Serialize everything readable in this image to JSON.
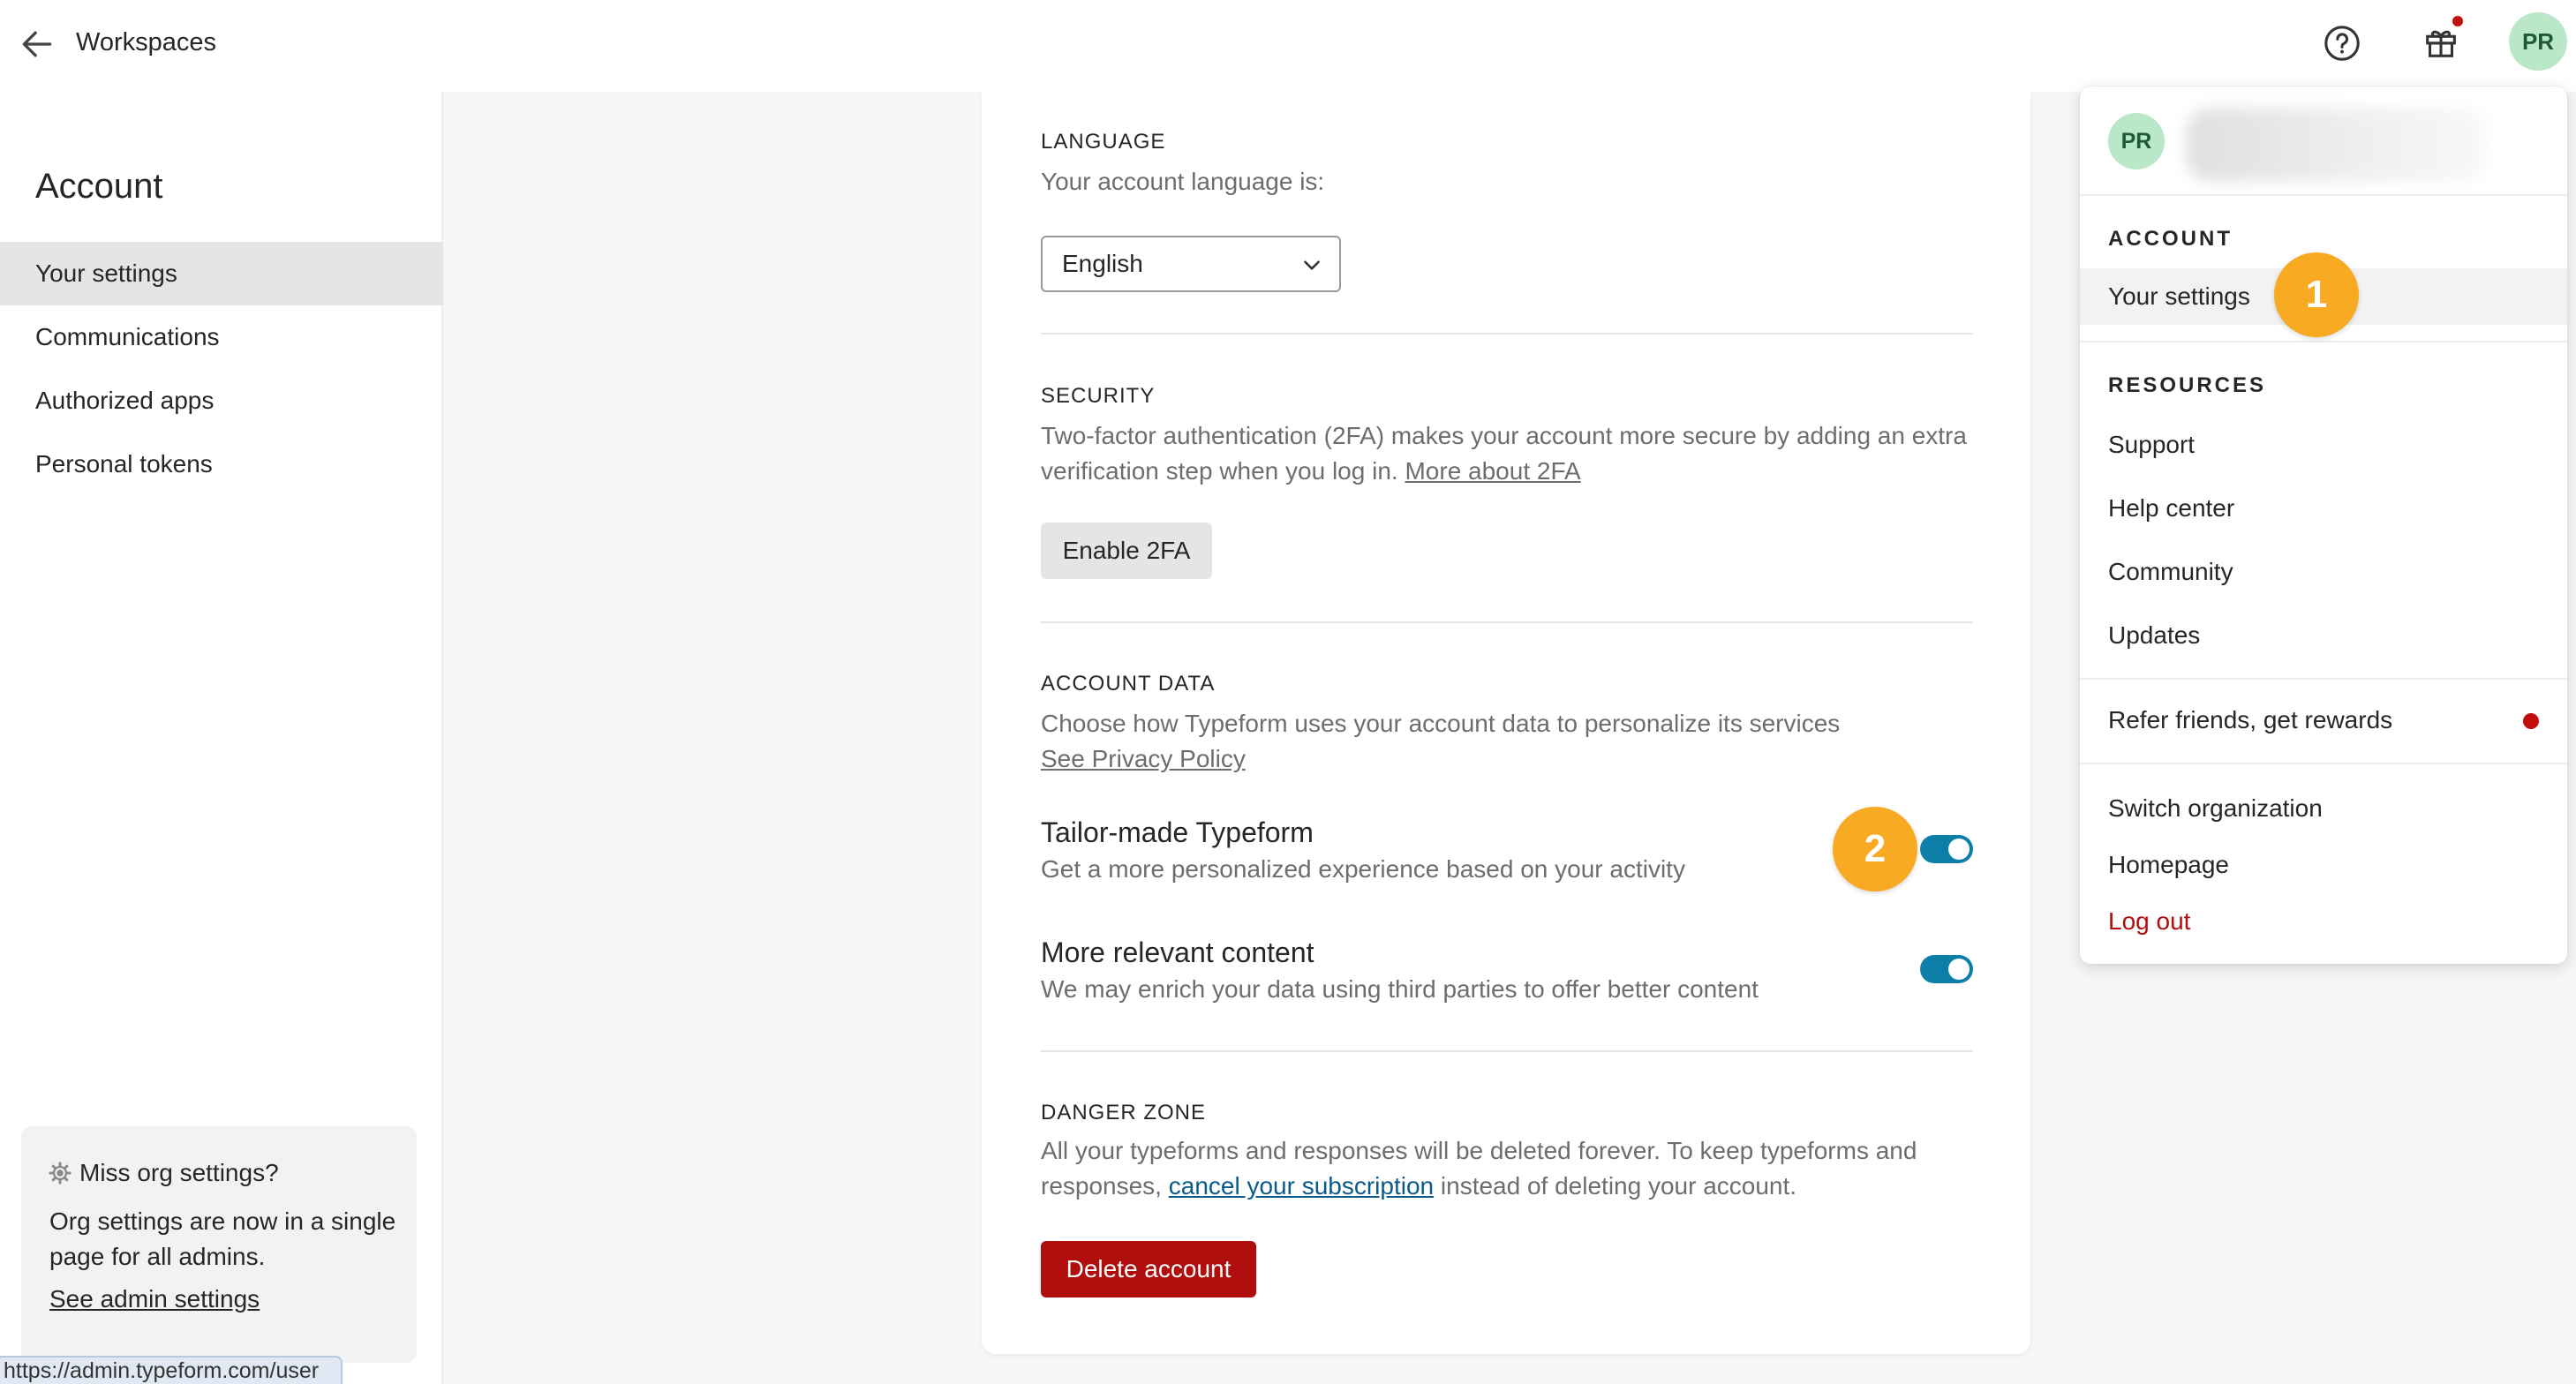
{
  "topbar": {
    "title": "Workspaces",
    "avatar_initials": "PR"
  },
  "sidebar": {
    "title": "Account",
    "items": [
      {
        "label": "Your settings",
        "active": true
      },
      {
        "label": "Communications"
      },
      {
        "label": "Authorized apps"
      },
      {
        "label": "Personal tokens"
      }
    ],
    "org_card": {
      "title": "Miss org settings?",
      "body": "Org settings are now in a single page for all admins.",
      "link": "See admin settings"
    }
  },
  "status_url": "https://admin.typeform.com/user",
  "main": {
    "language": {
      "label": "LANGUAGE",
      "text": "Your account language is:",
      "selected": "English"
    },
    "security": {
      "label": "SECURITY",
      "text": "Two-factor authentication (2FA) makes your account more secure by adding an extra verification step when you log in.",
      "link": "More about 2FA",
      "button": "Enable 2FA"
    },
    "account_data": {
      "label": "ACCOUNT DATA",
      "text": "Choose how Typeform uses your account data to personalize its services",
      "link": "See Privacy Policy",
      "prefs": [
        {
          "title": "Tailor-made Typeform",
          "desc": "Get a more personalized experience based on your activity",
          "enabled": true
        },
        {
          "title": "More relevant content",
          "desc": "We may enrich your data using third parties to offer better content",
          "enabled": true
        }
      ]
    },
    "danger": {
      "label": "DANGER ZONE",
      "text_before": "All your typeforms and responses will be deleted forever. To keep typeforms and responses, ",
      "link": "cancel your subscription",
      "text_after": " instead of deleting your account.",
      "button": "Delete account"
    }
  },
  "menu": {
    "avatar_initials": "PR",
    "account_heading": "ACCOUNT",
    "account_items": [
      "Your settings"
    ],
    "resources_heading": "RESOURCES",
    "resources_items": [
      "Support",
      "Help center",
      "Community",
      "Updates"
    ],
    "refer": "Refer friends, get rewards",
    "other_items": [
      "Switch organization",
      "Homepage"
    ],
    "logout": "Log out"
  },
  "badges": [
    "1",
    "2"
  ],
  "colors": {
    "accent": "#0d7ea8",
    "danger": "#b00d0d",
    "badge": "#f8aa22",
    "avatar": "#b9e7c8"
  }
}
